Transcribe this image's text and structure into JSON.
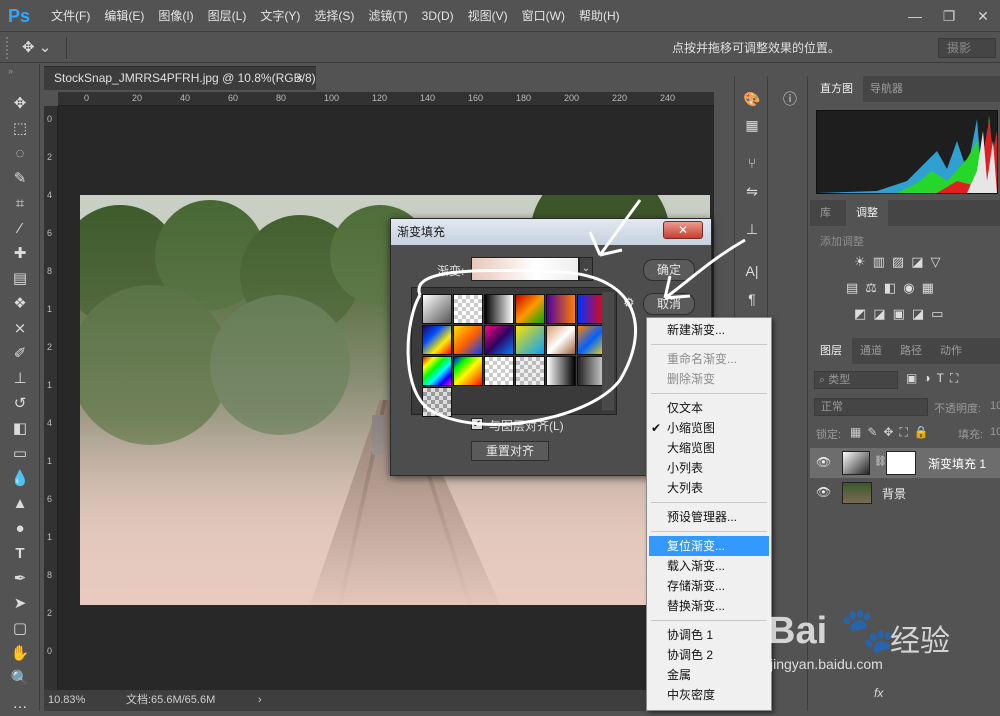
{
  "app": {
    "logo": "Ps"
  },
  "menu": [
    "文件(F)",
    "编辑(E)",
    "图像(I)",
    "图层(L)",
    "文字(Y)",
    "选择(S)",
    "滤镜(T)",
    "3D(D)",
    "视图(V)",
    "窗口(W)",
    "帮助(H)"
  ],
  "window_controls": {
    "minimize": "—",
    "restore": "❐",
    "close": "✕"
  },
  "options_bar": {
    "hint": "点按并拖移可调整效果的位置。",
    "workspace": "摄影"
  },
  "document": {
    "tab_title": "StockSnap_JMRRS4PFRH.jpg @ 10.8%(RGB/8)",
    "tab_close": "×",
    "ruler_ticks": [
      "0",
      "20",
      "40",
      "60",
      "80",
      "100",
      "120",
      "140",
      "160",
      "180",
      "200",
      "220",
      "240"
    ],
    "ruler_v_ticks": [
      "0",
      "2",
      "4",
      "6",
      "8",
      "1",
      "2",
      "1",
      "4",
      "1",
      "6",
      "1",
      "8",
      "2",
      "0"
    ],
    "zoom": "10.83%",
    "doc_size": "文档:65.6M/65.6M",
    "status_arrow": "›"
  },
  "right_panel": {
    "top_tabs": [
      "直方图",
      "导航器"
    ],
    "mid_tabs": [
      "库",
      "调整"
    ],
    "adjust_label": "添加调整",
    "layer_tabs": [
      "图层",
      "通道",
      "路径",
      "动作"
    ],
    "filter_label": "类型",
    "blend_mode": "正常",
    "opacity_label": "不透明度:",
    "opacity_value": "10",
    "lock_label": "锁定:",
    "fill_label": "填充:",
    "fill_value": "10",
    "layers": [
      {
        "name": "渐变填充 1",
        "selected": true
      },
      {
        "name": "背景",
        "selected": false
      }
    ],
    "bottom_icons": "fx"
  },
  "dialog": {
    "title": "渐变填充",
    "gradient_label": "渐变:",
    "ok": "确定",
    "cancel": "取消",
    "align_checkbox": "与图层对齐(L)",
    "reset_align": "重置对齐",
    "close": "✕",
    "gear": "⚙"
  },
  "context_menu": {
    "items": [
      {
        "label": "新建渐变...",
        "state": "normal"
      },
      {
        "label": "重命名渐变...",
        "state": "disabled"
      },
      {
        "label": "删除渐变",
        "state": "disabled"
      },
      {
        "label": "仅文本",
        "state": "normal"
      },
      {
        "label": "小缩览图",
        "state": "checked"
      },
      {
        "label": "大缩览图",
        "state": "normal"
      },
      {
        "label": "小列表",
        "state": "normal"
      },
      {
        "label": "大列表",
        "state": "normal"
      },
      {
        "label": "预设管理器...",
        "state": "normal"
      },
      {
        "label": "复位渐变...",
        "state": "highlighted"
      },
      {
        "label": "载入渐变...",
        "state": "normal"
      },
      {
        "label": "存储渐变...",
        "state": "normal"
      },
      {
        "label": "替换渐变...",
        "state": "normal"
      },
      {
        "label": "协调色 1",
        "state": "normal"
      },
      {
        "label": "协调色 2",
        "state": "normal"
      },
      {
        "label": "金属",
        "state": "normal"
      },
      {
        "label": "中灰密度",
        "state": "normal"
      }
    ],
    "check_mark": "✔"
  },
  "watermark": {
    "brand": "Bai",
    "brand2": "经验",
    "url": "jingyan.baidu.com"
  },
  "colors": {
    "accent": "#31a8ff",
    "highlight": "#3399ff",
    "panel": "#535353",
    "dark": "#282828"
  }
}
